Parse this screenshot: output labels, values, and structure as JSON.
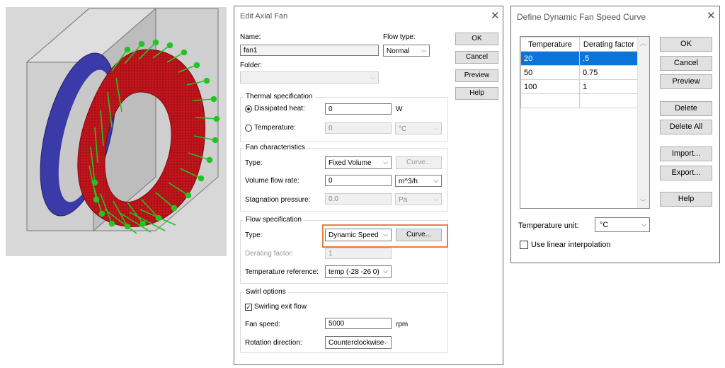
{
  "fan_dialog": {
    "title": "Edit Axial Fan",
    "close_glyph": "✕",
    "name_label": "Name:",
    "name_value": "fan1",
    "flow_type_label": "Flow type:",
    "flow_type_value": "Normal",
    "folder_label": "Folder:",
    "folder_value": "",
    "buttons": {
      "ok": "OK",
      "cancel": "Cancel",
      "preview": "Preview",
      "help": "Help"
    },
    "thermal": {
      "title": "Thermal specification",
      "dissipated_label": "Dissipated heat:",
      "dissipated_value": "0",
      "dissipated_unit": "W",
      "temperature_label": "Temperature:",
      "temperature_value": "0",
      "temperature_unit": "°C"
    },
    "fan_char": {
      "title": "Fan characteristics",
      "type_label": "Type:",
      "type_value": "Fixed Volume",
      "curve_button": "Curve...",
      "volume_label": "Volume flow rate:",
      "volume_value": "0",
      "volume_unit": "m^3/h",
      "stagnation_label": "Stagnation pressure:",
      "stagnation_value": "0.0",
      "stagnation_unit": "Pa"
    },
    "flow_spec": {
      "title": "Flow specification",
      "type_label": "Type:",
      "type_value": "Dynamic Speed",
      "curve_button": "Curve...",
      "derating_label": "Derating factor:",
      "derating_value": "1",
      "temp_ref_label": "Temperature reference:",
      "temp_ref_value": "temp (-28 -26 0)"
    },
    "swirl": {
      "title": "Swirl options",
      "swirl_check_label": "Swirling exit flow",
      "fan_speed_label": "Fan speed:",
      "fan_speed_value": "5000",
      "fan_speed_unit": "rpm",
      "rotation_label": "Rotation direction:",
      "rotation_value": "Counterclockwise"
    }
  },
  "curve_dialog": {
    "title": "Define Dynamic Fan Speed Curve",
    "close_glyph": "✕",
    "table": {
      "headers": [
        "Temperature",
        "Derating factor"
      ],
      "rows": [
        [
          "20",
          ".5"
        ],
        [
          "50",
          "0.75"
        ],
        [
          "100",
          "1"
        ],
        [
          "",
          ""
        ]
      ]
    },
    "buttons": {
      "ok": "OK",
      "cancel": "Cancel",
      "preview": "Preview",
      "delete": "Delete",
      "delete_all": "Delete All",
      "import": "Import...",
      "export": "Export...",
      "help": "Help"
    },
    "temp_unit_label": "Temperature unit:",
    "temp_unit_value": "°C",
    "linear_label": "Use linear interpolation"
  },
  "icons": {
    "chevron": "⌵",
    "scroll_up": "︿",
    "scroll_down": "﹀",
    "check_mark": "✓"
  },
  "colors": {
    "highlight": "#e8803a",
    "selection": "#0a74da",
    "fan_ring": "#c0141c",
    "hub_blue": "#3a3aa8",
    "arrow_green": "#22c422"
  }
}
